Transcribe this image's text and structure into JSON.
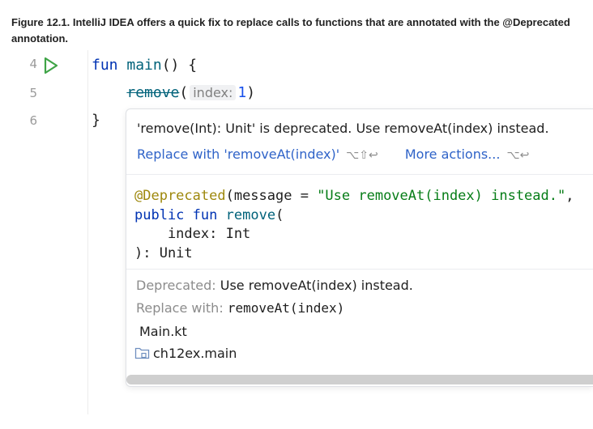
{
  "caption": "Figure 12.1. IntelliJ IDEA offers a quick fix to replace calls to functions that are annotated with the @Deprecated annotation.",
  "editor": {
    "line_numbers": [
      "4",
      "5",
      "6"
    ],
    "line1": {
      "kw": "fun",
      "name": "main",
      "rest": "() {"
    },
    "line2": {
      "call": "remove",
      "open": "(",
      "hint": "index:",
      "arg": "1",
      "close": ")"
    },
    "line3": "}"
  },
  "popup": {
    "message": "'remove(Int): Unit' is deprecated. Use removeAt(index) instead.",
    "replace_action": "Replace with 'removeAt(index)'",
    "replace_shortcut": "⌥⇧↩",
    "more_actions": "More actions...",
    "more_shortcut": "⌥↩",
    "declaration": {
      "annotation": "@Deprecated",
      "ann_open": "(message = ",
      "ann_string": "\"Use removeAt(index) instead.\"",
      "ann_tail": ",",
      "kw_public": "public",
      "kw_fun": "fun",
      "fn_name": "remove",
      "fn_open": "(",
      "param": "    index: Int",
      "ret": "): Unit"
    },
    "deprecated_label": "Deprecated:",
    "deprecated_value": "Use removeAt(index) instead.",
    "replace_label": "Replace with:",
    "replace_value": "removeAt(index)",
    "file": "Main.kt",
    "package": "ch12ex.main"
  }
}
